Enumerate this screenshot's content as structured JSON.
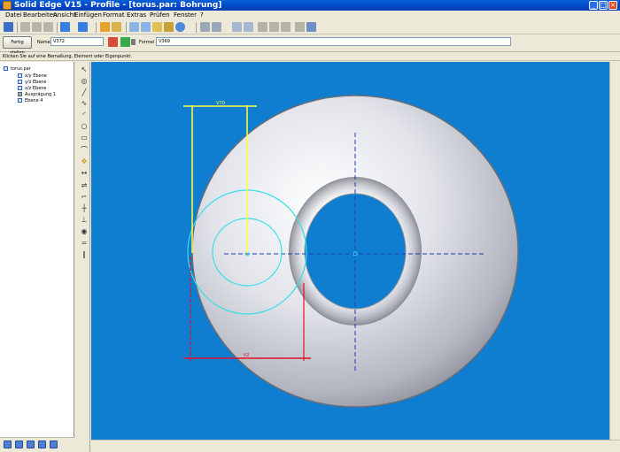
{
  "window": {
    "title": "Solid Edge V15 - Profile - [torus.par: Bohrung]",
    "minimize_glyph": "_",
    "maximize_glyph": "□",
    "close_glyph": "×"
  },
  "menu": {
    "items": [
      "Datei",
      "Bearbeiten",
      "Ansicht",
      "Einfügen",
      "Format",
      "Extras",
      "Prüfen",
      "Fenster",
      "?"
    ]
  },
  "command_bar": {
    "done_label": "Fertig stellen",
    "name_label": "Name",
    "name_value": "V372",
    "formula_label": "Formel",
    "formula_value": "V369"
  },
  "status": {
    "prompt": "Klicken Sie auf eine Bemaßung, Element oder Eigenpunkt."
  },
  "feature_tree": {
    "items": [
      {
        "label": "torus.par",
        "icon": "part-icon"
      },
      {
        "label": "x/y Ebene",
        "icon": "plane-icon"
      },
      {
        "label": "y/z Ebene",
        "icon": "plane-icon"
      },
      {
        "label": "x/z Ebene",
        "icon": "plane-icon"
      },
      {
        "label": "Ausprägung 1",
        "icon": "protrusion-icon"
      },
      {
        "label": "Ebene 4",
        "icon": "plane-icon"
      }
    ]
  },
  "dimensions": {
    "upper_label": "V70",
    "lower_label": "V2"
  },
  "colors": {
    "viewport_bg": "#0f7ed1",
    "dimension_yellow": "#ffff3a",
    "dimension_red": "#e1102a",
    "sketch_cyan": "#32e0e8",
    "axis_blue": "#1d3bb5"
  }
}
